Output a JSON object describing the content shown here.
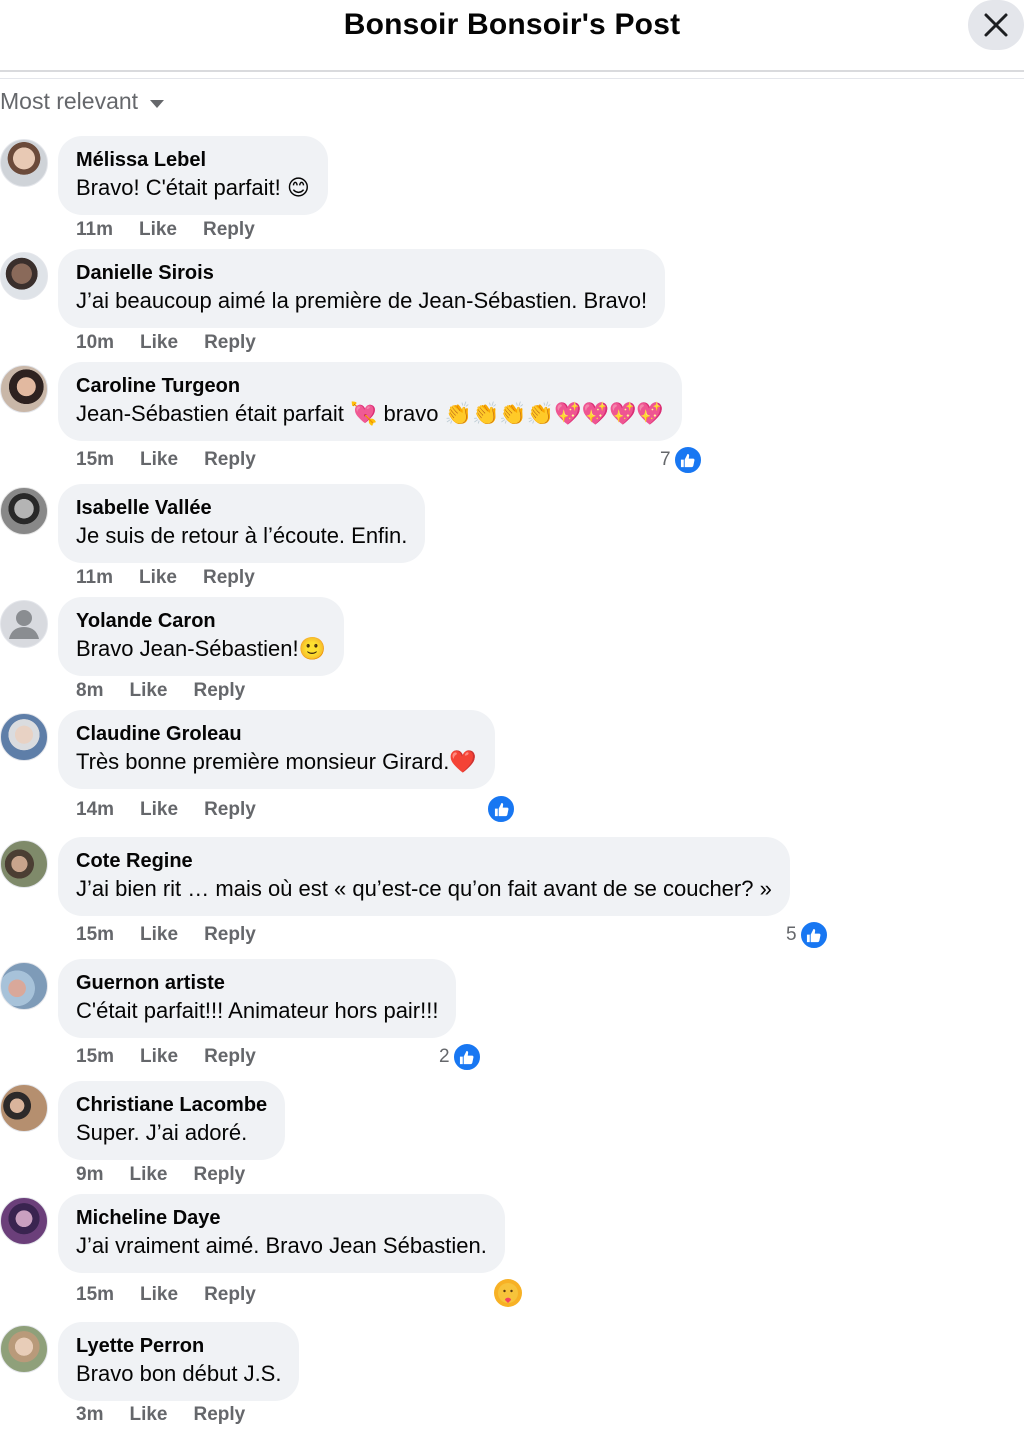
{
  "header": {
    "title": "Bonsoir Bonsoir's Post",
    "close_icon": "close-icon"
  },
  "sort": {
    "label": "Most relevant",
    "icon": "caret-down-icon"
  },
  "actions": {
    "like": "Like",
    "reply": "Reply"
  },
  "comments": [
    {
      "author": "Mélissa Lebel",
      "text": "Bravo! C'était parfait! 😊",
      "time": "11m",
      "reactions": ""
    },
    {
      "author": "Danielle Sirois",
      "text": "J’ai beaucoup aimé la première de Jean-Sébastien. Bravo!",
      "time": "10m",
      "reactions": ""
    },
    {
      "author": "Caroline Turgeon",
      "text": "Jean-Sébastien était parfait 💘 bravo 👏👏👏👏💖💖💖💖",
      "time": "15m",
      "reactions": "7"
    },
    {
      "author": "Isabelle Vallée",
      "text": "Je suis de retour à l’écoute. Enfin.",
      "time": "11m",
      "reactions": ""
    },
    {
      "author": "Yolande Caron",
      "text": "Bravo Jean-Sébastien!🙂",
      "time": "8m",
      "reactions": ""
    },
    {
      "author": "Claudine Groleau",
      "text": "Très bonne première monsieur Girard.❤️",
      "time": "14m",
      "reactions": ""
    },
    {
      "author": "Cote Regine",
      "text": "J’ai bien rit … mais où est « qu’est-ce qu’on fait avant de se coucher? »",
      "time": "15m",
      "reactions": "5"
    },
    {
      "author": "Guernon artiste",
      "text": "C'était parfait!!! Animateur hors pair!!!",
      "time": "15m",
      "reactions": "2"
    },
    {
      "author": "Christiane Lacombe",
      "text": "Super. J’ai adoré.",
      "time": "9m",
      "reactions": ""
    },
    {
      "author": "Micheline Daye",
      "text": "J’ai vraiment aimé. Bravo Jean Sébastien.",
      "time": "15m",
      "reactions": ""
    },
    {
      "author": "Lyette Perron",
      "text": "Bravo bon début J.S.",
      "time": "3m",
      "reactions": ""
    }
  ],
  "colors": {
    "like_blue": "#1877f2",
    "bubble_bg": "#f0f2f5",
    "meta_gray": "#65676b"
  }
}
